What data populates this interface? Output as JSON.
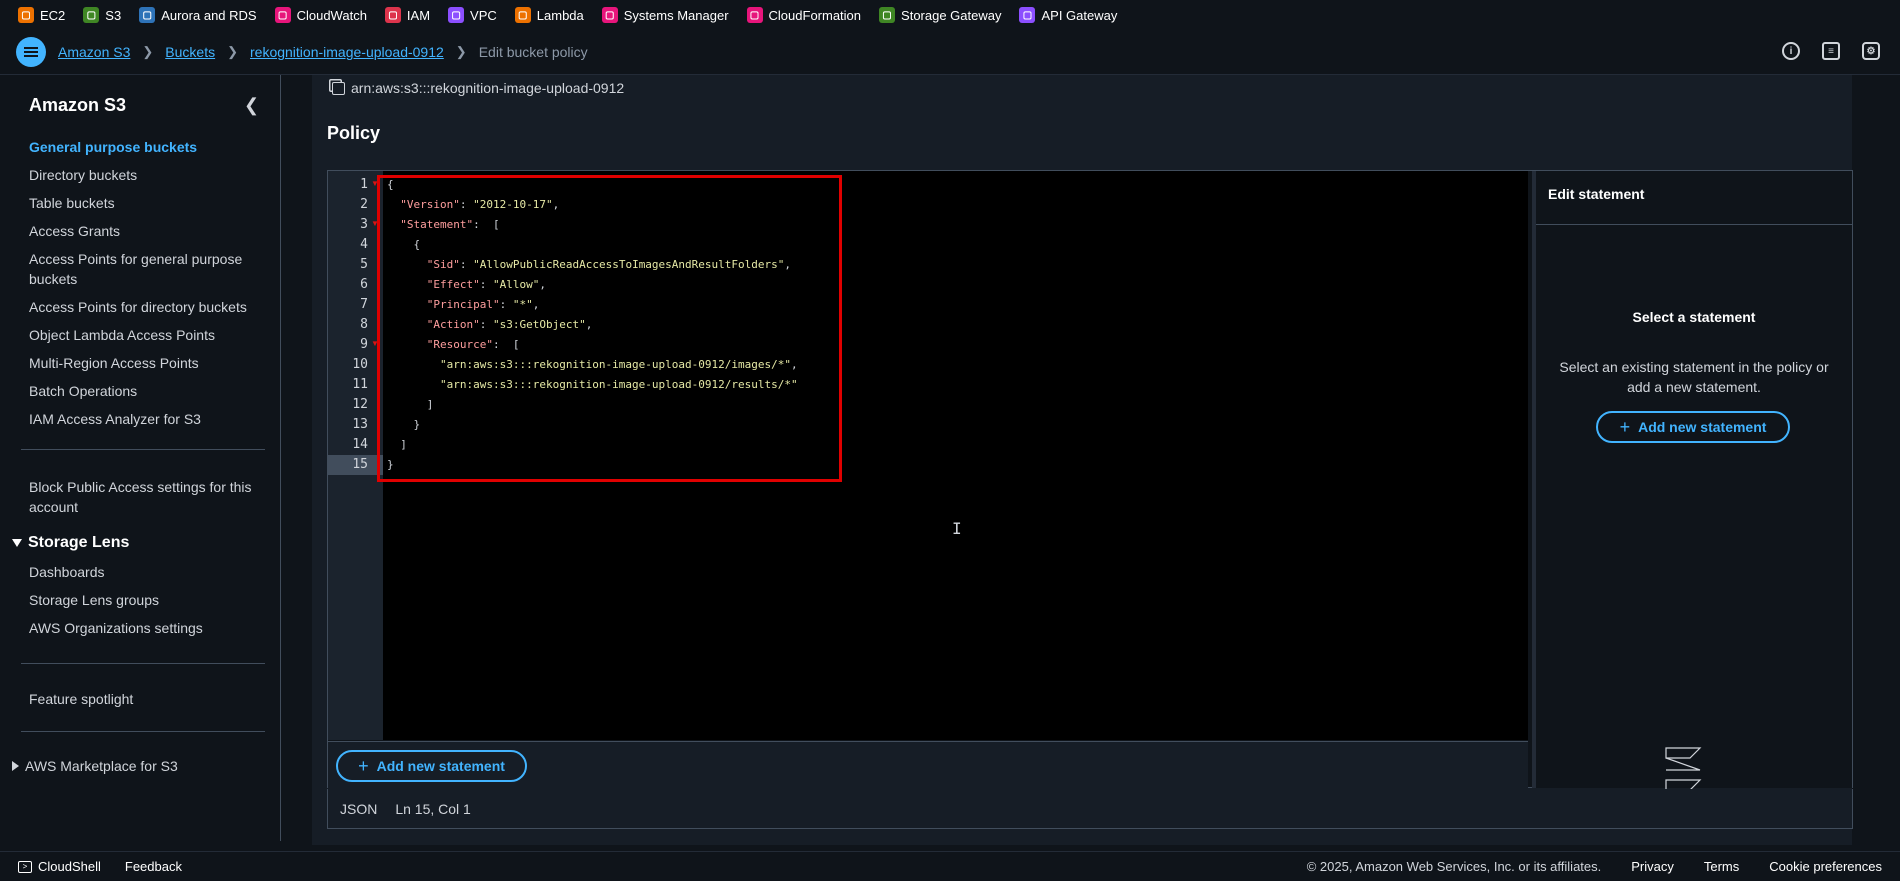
{
  "favorites": [
    {
      "label": "EC2",
      "icon": "ec2-icon",
      "color": "#ed7100"
    },
    {
      "label": "S3",
      "icon": "s3-icon",
      "color": "#3f8624"
    },
    {
      "label": "Aurora and RDS",
      "icon": "rds-icon",
      "color": "#2e73b8"
    },
    {
      "label": "CloudWatch",
      "icon": "cloudwatch-icon",
      "color": "#e7157b"
    },
    {
      "label": "IAM",
      "icon": "iam-icon",
      "color": "#dd344c"
    },
    {
      "label": "VPC",
      "icon": "vpc-icon",
      "color": "#8c4fff"
    },
    {
      "label": "Lambda",
      "icon": "lambda-icon",
      "color": "#ed7100"
    },
    {
      "label": "Systems Manager",
      "icon": "systems-manager-icon",
      "color": "#e7157b"
    },
    {
      "label": "CloudFormation",
      "icon": "cloudformation-icon",
      "color": "#e7157b"
    },
    {
      "label": "Storage Gateway",
      "icon": "storage-gateway-icon",
      "color": "#3f8624"
    },
    {
      "label": "API Gateway",
      "icon": "api-gateway-icon",
      "color": "#8c4fff"
    }
  ],
  "breadcrumb": {
    "items": [
      "Amazon S3",
      "Buckets",
      "rekognition-image-upload-0912"
    ],
    "current": "Edit bucket policy"
  },
  "sidebar": {
    "title": "Amazon S3",
    "items": [
      "General purpose buckets",
      "Directory buckets",
      "Table buckets",
      "Access Grants",
      "Access Points for general purpose buckets",
      "Access Points for directory buckets",
      "Object Lambda Access Points",
      "Multi-Region Access Points",
      "Batch Operations",
      "IAM Access Analyzer for S3"
    ],
    "block_public": "Block Public Access settings for this account",
    "storage_lens": {
      "title": "Storage Lens",
      "items": [
        "Dashboards",
        "Storage Lens groups",
        "AWS Organizations settings"
      ]
    },
    "feature_spotlight": "Feature spotlight",
    "marketplace": "AWS Marketplace for S3"
  },
  "main": {
    "arn": "arn:aws:s3:::rekognition-image-upload-0912",
    "policy_heading": "Policy",
    "editor": {
      "line_numbers": [
        "1",
        "2",
        "3",
        "4",
        "5",
        "6",
        "7",
        "8",
        "9",
        "10",
        "11",
        "12",
        "13",
        "14",
        "15"
      ],
      "lines": [
        {
          "indent": "",
          "key": "",
          "value": "",
          "punct": "{"
        },
        {
          "indent": "  ",
          "key": "\"Version\"",
          "value": "\"2012-10-17\"",
          "punct": ","
        },
        {
          "indent": "  ",
          "key": "\"Statement\"",
          "value": "",
          "punct": " ["
        },
        {
          "indent": "    ",
          "key": "",
          "value": "",
          "punct": "{"
        },
        {
          "indent": "      ",
          "key": "\"Sid\"",
          "value": "\"AllowPublicReadAccessToImagesAndResultFolders\"",
          "punct": ","
        },
        {
          "indent": "      ",
          "key": "\"Effect\"",
          "value": "\"Allow\"",
          "punct": ","
        },
        {
          "indent": "      ",
          "key": "\"Principal\"",
          "value": "\"*\"",
          "punct": ","
        },
        {
          "indent": "      ",
          "key": "\"Action\"",
          "value": "\"s3:GetObject\"",
          "punct": ","
        },
        {
          "indent": "      ",
          "key": "\"Resource\"",
          "value": "",
          "punct": " ["
        },
        {
          "indent": "        ",
          "key": "",
          "value": "\"arn:aws:s3:::rekognition-image-upload-0912/images/*\"",
          "punct": ","
        },
        {
          "indent": "        ",
          "key": "",
          "value": "\"arn:aws:s3:::rekognition-image-upload-0912/results/*\"",
          "punct": ""
        },
        {
          "indent": "      ",
          "key": "",
          "value": "",
          "punct": "]"
        },
        {
          "indent": "    ",
          "key": "",
          "value": "",
          "punct": "}"
        },
        {
          "indent": "  ",
          "key": "",
          "value": "",
          "punct": "]"
        },
        {
          "indent": "",
          "key": "",
          "value": "",
          "punct": "}"
        }
      ],
      "active_line": "15"
    },
    "add_statement_label": "Add new statement",
    "status": {
      "mode": "JSON",
      "position": "Ln 15, Col 1"
    },
    "side_panel": {
      "title": "Edit statement",
      "subtitle": "Select a statement",
      "description": "Select an existing statement in the policy or add a new statement.",
      "button_label": "Add new statement"
    }
  },
  "bottom": {
    "cloudshell": "CloudShell",
    "feedback": "Feedback",
    "copyright": "© 2025, Amazon Web Services, Inc. or its affiliates.",
    "links": [
      "Privacy",
      "Terms",
      "Cookie preferences"
    ]
  }
}
